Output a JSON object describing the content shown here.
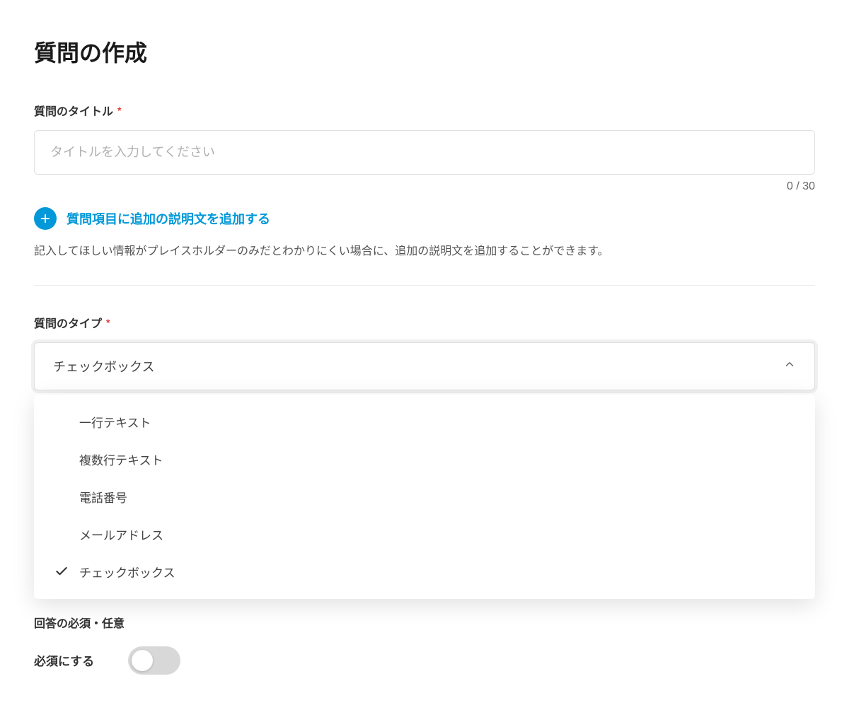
{
  "page": {
    "title": "質問の作成"
  },
  "titleField": {
    "label": "質問のタイトル",
    "required_mark": "*",
    "placeholder": "タイトルを入力してください",
    "counter": "0 / 30"
  },
  "addDescription": {
    "label": "質問項目に追加の説明文を追加する",
    "help": "記入してほしい情報がプレイスホルダーのみだとわかりにくい場合に、追加の説明文を追加することができます。"
  },
  "typeField": {
    "label": "質問のタイプ",
    "required_mark": "*",
    "selected": "チェックボックス",
    "options": [
      {
        "label": "一行テキスト",
        "checked": false
      },
      {
        "label": "複数行テキスト",
        "checked": false
      },
      {
        "label": "電話番号",
        "checked": false
      },
      {
        "label": "メールアドレス",
        "checked": false
      },
      {
        "label": "チェックボックス",
        "checked": true
      }
    ]
  },
  "requiredField": {
    "section_label": "回答の必須・任意",
    "toggle_label": "必須にする",
    "toggle_on": false
  }
}
